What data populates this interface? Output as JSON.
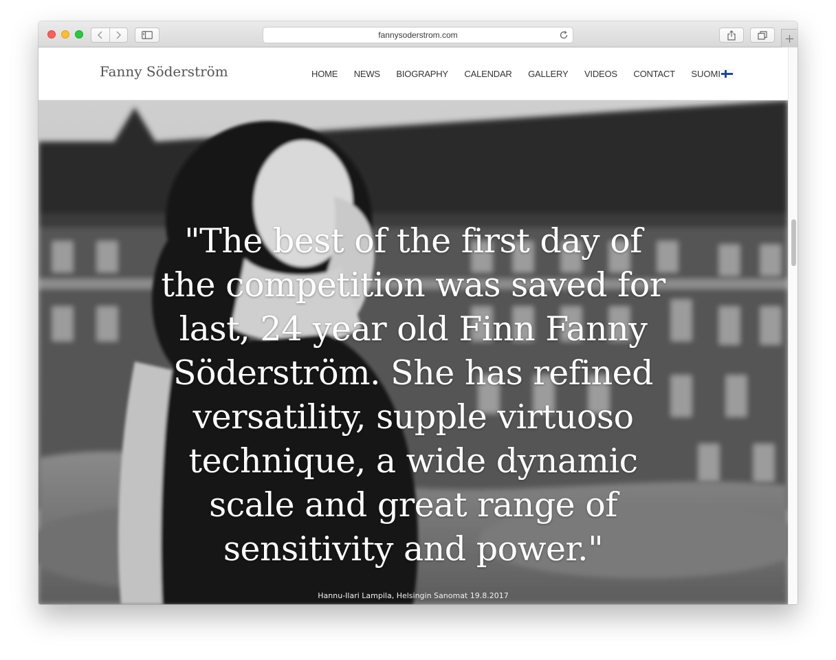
{
  "browser": {
    "url": "fannysoderstrom.com",
    "icons": {
      "back": "chevron-left-icon",
      "forward": "chevron-right-icon",
      "sidebar": "sidebar-icon",
      "reload": "reload-icon",
      "share": "share-icon",
      "tabs": "tabs-icon",
      "new_tab": "plus-icon"
    }
  },
  "site": {
    "brand": "Fanny Söderström",
    "nav": [
      {
        "label": "HOME"
      },
      {
        "label": "NEWS"
      },
      {
        "label": "BIOGRAPHY"
      },
      {
        "label": "CALENDAR"
      },
      {
        "label": "GALLERY"
      },
      {
        "label": "VIDEOS"
      },
      {
        "label": "CONTACT"
      }
    ],
    "language": {
      "label": "SUOMI",
      "flag": "finnish-flag-icon"
    }
  },
  "hero": {
    "quote": "\"The best of the first day of the competition was saved for last, 24 year old Finn Fanny Söderström. She has refined versatility, supple virtuoso technique, a wide dynamic scale and great range of sensitivity and power.\"",
    "citation": "Hannu-Ilari Lampila, Helsingin Sanomat 19.8.2017"
  },
  "colors": {
    "text_dark": "#333333",
    "brand_gray": "#555555",
    "flag_blue": "#1a47a8",
    "hero_text": "#ffffff"
  }
}
